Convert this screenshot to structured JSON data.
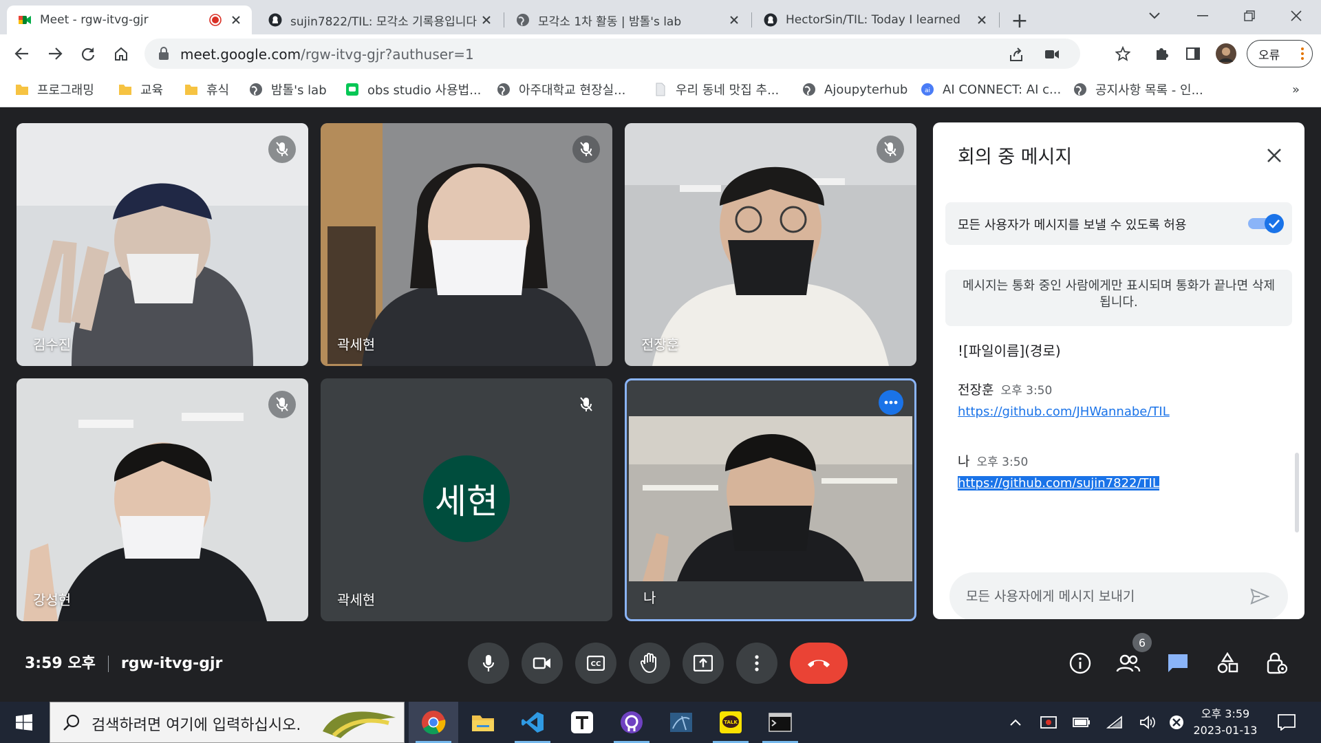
{
  "browser": {
    "tabs": [
      {
        "title": "Meet - rgw-itvg-gjr",
        "active": true,
        "recording": true
      },
      {
        "title": "sujin7822/TIL: 모각소 기록용입니다",
        "active": false
      },
      {
        "title": "모각소 1차 활동 | 밤톨's lab",
        "active": false
      },
      {
        "title": "HectorSin/TIL: Today I learned",
        "active": false
      }
    ],
    "new_tab": "+",
    "address": {
      "host": "meet.google.com",
      "path": "/rgw-itvg-gjr?authuser=1"
    },
    "profile_label": "오류",
    "bookmarks": [
      {
        "label": "프로그래밍",
        "icon": "folder-icon"
      },
      {
        "label": "교육",
        "icon": "folder-icon"
      },
      {
        "label": "휴식",
        "icon": "folder-icon"
      },
      {
        "label": "밤톨's lab",
        "icon": "globe-icon"
      },
      {
        "label": "obs studio 사용법...",
        "icon": "line-icon"
      },
      {
        "label": "아주대학교 현장실...",
        "icon": "globe-icon"
      },
      {
        "label": "우리 동네 맛집 추...",
        "icon": "page-icon"
      },
      {
        "label": "Ajoupyterhub",
        "icon": "globe-icon"
      },
      {
        "label": "AI CONNECT: AI c...",
        "icon": "ai-icon"
      },
      {
        "label": "공지사항 목록 - 인...",
        "icon": "globe-icon"
      }
    ],
    "bookmarks_more": "»"
  },
  "participants": [
    {
      "name": "김수진",
      "muted": true
    },
    {
      "name": "곽세현",
      "muted": true
    },
    {
      "name": "전장훈",
      "muted": true
    },
    {
      "name": "강성현",
      "muted": true
    },
    {
      "name": "곽세현",
      "muted": true,
      "avatar_text": "세현",
      "avatar_color": "#004d3d"
    },
    {
      "name": "나",
      "muted": false,
      "self": true
    }
  ],
  "chat": {
    "title": "회의 중 메시지",
    "toggle_label": "모든 사용자가 메시지를 보낼 수 있도록 허용",
    "toggle_on": true,
    "info": "메시지는 통화 중인 사람에게만 표시되며 통화가 끝나면 삭제됩니다.",
    "messages": [
      {
        "text": "![파일이름](경로)"
      },
      {
        "sender": "전장훈",
        "time": "오후 3:50",
        "link": "https://github.com/JHWannabe/TIL"
      },
      {
        "sender": "나",
        "time": "오후 3:50",
        "link": "https://github.com/sujin7822/TIL",
        "selected": true
      }
    ],
    "compose_placeholder": "모든 사용자에게 메시지 보내기"
  },
  "bottom": {
    "time": "3:59 오후",
    "meeting_code": "rgw-itvg-gjr",
    "people_count": "6"
  },
  "colors": {
    "meet_bg": "#202124",
    "accent_blue": "#1a73e8",
    "hangup_red": "#ea4335",
    "avatar_green": "#004d3d"
  },
  "taskbar": {
    "search_placeholder": "검색하려면 여기에 입력하십시오.",
    "time": "오후 3:59",
    "date": "2023-01-13"
  }
}
